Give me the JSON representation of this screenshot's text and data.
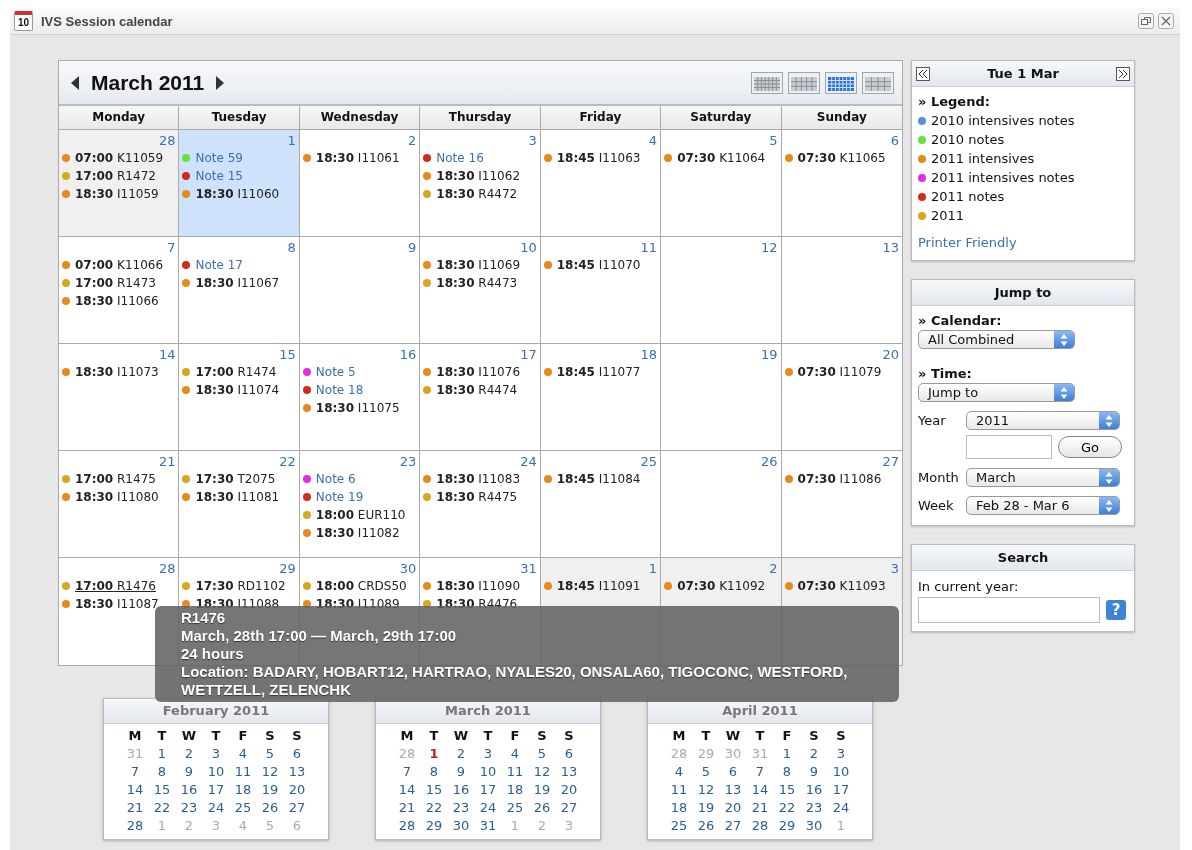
{
  "window": {
    "icon_text": "10",
    "title": "IVS Session calendar"
  },
  "calendar": {
    "title": "March 2011",
    "view_buttons": [
      {
        "selected": false
      },
      {
        "selected": false
      },
      {
        "selected": true
      },
      {
        "selected": false
      }
    ],
    "weekdays": [
      "Monday",
      "Tuesday",
      "Wednesday",
      "Thursday",
      "Friday",
      "Saturday",
      "Sunday"
    ],
    "weeks": [
      [
        {
          "day": "28",
          "other_month": true,
          "selected": false,
          "events": [
            {
              "kind": "session",
              "color": "#e68a1f",
              "time": "07:00",
              "code": "K11059"
            },
            {
              "kind": "session",
              "color": "#d7a81e",
              "time": "17:00",
              "code": "R1472"
            },
            {
              "kind": "session",
              "color": "#e68a1f",
              "time": "18:30",
              "code": "I11059"
            }
          ]
        },
        {
          "day": "1",
          "other_month": false,
          "selected": true,
          "events": [
            {
              "kind": "note",
              "color": "#66e03a",
              "code": "Note 59"
            },
            {
              "kind": "note",
              "color": "#d42a1d",
              "code": "Note 15"
            },
            {
              "kind": "session",
              "color": "#e68a1f",
              "time": "18:30",
              "code": "I11060"
            }
          ]
        },
        {
          "day": "2",
          "other_month": false,
          "selected": false,
          "events": [
            {
              "kind": "session",
              "color": "#e68a1f",
              "time": "18:30",
              "code": "I11061"
            }
          ]
        },
        {
          "day": "3",
          "other_month": false,
          "selected": false,
          "events": [
            {
              "kind": "note",
              "color": "#d42a1d",
              "code": "Note 16"
            },
            {
              "kind": "session",
              "color": "#e68a1f",
              "time": "18:30",
              "code": "I11062"
            },
            {
              "kind": "session",
              "color": "#d7a81e",
              "time": "18:30",
              "code": "R4472"
            }
          ]
        },
        {
          "day": "4",
          "other_month": false,
          "selected": false,
          "events": [
            {
              "kind": "session",
              "color": "#e68a1f",
              "time": "18:45",
              "code": "I11063"
            }
          ]
        },
        {
          "day": "5",
          "other_month": false,
          "selected": false,
          "events": [
            {
              "kind": "session",
              "color": "#e68a1f",
              "time": "07:30",
              "code": "K11064"
            }
          ]
        },
        {
          "day": "6",
          "other_month": false,
          "selected": false,
          "events": [
            {
              "kind": "session",
              "color": "#e68a1f",
              "time": "07:30",
              "code": "K11065"
            }
          ]
        }
      ],
      [
        {
          "day": "7",
          "other_month": false,
          "selected": false,
          "events": [
            {
              "kind": "session",
              "color": "#e68a1f",
              "time": "07:00",
              "code": "K11066"
            },
            {
              "kind": "session",
              "color": "#d7a81e",
              "time": "17:00",
              "code": "R1473"
            },
            {
              "kind": "session",
              "color": "#e68a1f",
              "time": "18:30",
              "code": "I11066"
            }
          ]
        },
        {
          "day": "8",
          "other_month": false,
          "selected": false,
          "events": [
            {
              "kind": "note",
              "color": "#d42a1d",
              "code": "Note 17"
            },
            {
              "kind": "session",
              "color": "#e68a1f",
              "time": "18:30",
              "code": "I11067"
            }
          ]
        },
        {
          "day": "9",
          "other_month": false,
          "selected": false
        },
        {
          "day": "10",
          "other_month": false,
          "selected": false,
          "events": [
            {
              "kind": "session",
              "color": "#e68a1f",
              "time": "18:30",
              "code": "I11069"
            },
            {
              "kind": "session",
              "color": "#d7a81e",
              "time": "18:30",
              "code": "R4473"
            }
          ]
        },
        {
          "day": "11",
          "other_month": false,
          "selected": false,
          "events": [
            {
              "kind": "session",
              "color": "#e68a1f",
              "time": "18:45",
              "code": "I11070"
            }
          ]
        },
        {
          "day": "12",
          "other_month": false,
          "selected": false
        },
        {
          "day": "13",
          "other_month": false,
          "selected": false
        }
      ],
      [
        {
          "day": "14",
          "other_month": false,
          "selected": false,
          "events": [
            {
              "kind": "session",
              "color": "#e68a1f",
              "time": "18:30",
              "code": "I11073"
            }
          ]
        },
        {
          "day": "15",
          "other_month": false,
          "selected": false,
          "events": [
            {
              "kind": "session",
              "color": "#d7a81e",
              "time": "17:00",
              "code": "R1474"
            },
            {
              "kind": "session",
              "color": "#e68a1f",
              "time": "18:30",
              "code": "I11074"
            }
          ]
        },
        {
          "day": "16",
          "other_month": false,
          "selected": false,
          "events": [
            {
              "kind": "note",
              "color": "#e02ee0",
              "code": "Note 5"
            },
            {
              "kind": "note",
              "color": "#d42a1d",
              "code": "Note 18"
            },
            {
              "kind": "session",
              "color": "#e68a1f",
              "time": "18:30",
              "code": "I11075"
            }
          ]
        },
        {
          "day": "17",
          "other_month": false,
          "selected": false,
          "events": [
            {
              "kind": "session",
              "color": "#e68a1f",
              "time": "18:30",
              "code": "I11076"
            },
            {
              "kind": "session",
              "color": "#d7a81e",
              "time": "18:30",
              "code": "R4474"
            }
          ]
        },
        {
          "day": "18",
          "other_month": false,
          "selected": false,
          "events": [
            {
              "kind": "session",
              "color": "#e68a1f",
              "time": "18:45",
              "code": "I11077"
            }
          ]
        },
        {
          "day": "19",
          "other_month": false,
          "selected": false
        },
        {
          "day": "20",
          "other_month": false,
          "selected": false,
          "events": [
            {
              "kind": "session",
              "color": "#e68a1f",
              "time": "07:30",
              "code": "I11079"
            }
          ]
        }
      ],
      [
        {
          "day": "21",
          "other_month": false,
          "selected": false,
          "events": [
            {
              "kind": "session",
              "color": "#d7a81e",
              "time": "17:00",
              "code": "R1475"
            },
            {
              "kind": "session",
              "color": "#e68a1f",
              "time": "18:30",
              "code": "I11080"
            }
          ]
        },
        {
          "day": "22",
          "other_month": false,
          "selected": false,
          "events": [
            {
              "kind": "session",
              "color": "#d7a81e",
              "time": "17:30",
              "code": "T2075"
            },
            {
              "kind": "session",
              "color": "#e68a1f",
              "time": "18:30",
              "code": "I11081"
            }
          ]
        },
        {
          "day": "23",
          "other_month": false,
          "selected": false,
          "events": [
            {
              "kind": "note",
              "color": "#e02ee0",
              "code": "Note 6"
            },
            {
              "kind": "note",
              "color": "#d42a1d",
              "code": "Note 19"
            },
            {
              "kind": "session",
              "color": "#d7a81e",
              "time": "18:00",
              "code": "EUR110"
            },
            {
              "kind": "session",
              "color": "#e68a1f",
              "time": "18:30",
              "code": "I11082"
            }
          ]
        },
        {
          "day": "24",
          "other_month": false,
          "selected": false,
          "events": [
            {
              "kind": "session",
              "color": "#e68a1f",
              "time": "18:30",
              "code": "I11083"
            },
            {
              "kind": "session",
              "color": "#d7a81e",
              "time": "18:30",
              "code": "R4475"
            }
          ]
        },
        {
          "day": "25",
          "other_month": false,
          "selected": false,
          "events": [
            {
              "kind": "session",
              "color": "#e68a1f",
              "time": "18:45",
              "code": "I11084"
            }
          ]
        },
        {
          "day": "26",
          "other_month": false,
          "selected": false
        },
        {
          "day": "27",
          "other_month": false,
          "selected": false,
          "events": [
            {
              "kind": "session",
              "color": "#e68a1f",
              "time": "07:30",
              "code": "I11086"
            }
          ]
        }
      ],
      [
        {
          "day": "28",
          "other_month": false,
          "selected": false,
          "events": [
            {
              "kind": "session",
              "color": "#d7a81e",
              "time": "17:00",
              "code": "R1476",
              "hovered": true
            },
            {
              "kind": "session",
              "color": "#e68a1f",
              "time": "18:30",
              "code": "I11087"
            }
          ]
        },
        {
          "day": "29",
          "other_month": false,
          "selected": false,
          "events": [
            {
              "kind": "session",
              "color": "#d7a81e",
              "time": "17:30",
              "code": "RD1102"
            },
            {
              "kind": "session",
              "color": "#e68a1f",
              "time": "18:30",
              "code": "I11088"
            }
          ]
        },
        {
          "day": "30",
          "other_month": false,
          "selected": false,
          "events": [
            {
              "kind": "session",
              "color": "#d7a81e",
              "time": "18:00",
              "code": "CRDS50"
            },
            {
              "kind": "session",
              "color": "#e68a1f",
              "time": "18:30",
              "code": "I11089"
            }
          ]
        },
        {
          "day": "31",
          "other_month": false,
          "selected": false,
          "events": [
            {
              "kind": "session",
              "color": "#e68a1f",
              "time": "18:30",
              "code": "I11090"
            },
            {
              "kind": "session",
              "color": "#d7a81e",
              "time": "18:30",
              "code": "R4476"
            }
          ]
        },
        {
          "day": "1",
          "other_month": true,
          "selected": false,
          "events": [
            {
              "kind": "session",
              "color": "#e68a1f",
              "time": "18:45",
              "code": "I11091"
            }
          ]
        },
        {
          "day": "2",
          "other_month": true,
          "selected": false,
          "events": [
            {
              "kind": "session",
              "color": "#e68a1f",
              "time": "07:30",
              "code": "K11092"
            }
          ]
        },
        {
          "day": "3",
          "other_month": true,
          "selected": false,
          "events": [
            {
              "kind": "session",
              "color": "#e68a1f",
              "time": "07:30",
              "code": "K11093"
            }
          ]
        }
      ]
    ]
  },
  "tooltip": {
    "title": "R1476",
    "range": "March, 28th 17:00 — March, 29th 17:00",
    "duration": "24 hours",
    "location": "Location: BADARY, HOBART12, HARTRAO, NYALES20, ONSALA60, TIGOCONC, WESTFORD, WETTZELL, ZELENCHK"
  },
  "mini_calendars": [
    {
      "title": "February 2011",
      "weekdays": [
        "M",
        "T",
        "W",
        "T",
        "F",
        "S",
        "S"
      ],
      "weeks": [
        [
          {
            "day": "31",
            "kind": "other"
          },
          {
            "day": "1",
            "kind": "current"
          },
          {
            "day": "2",
            "kind": "current"
          },
          {
            "day": "3",
            "kind": "current"
          },
          {
            "day": "4",
            "kind": "current"
          },
          {
            "day": "5",
            "kind": "current"
          },
          {
            "day": "6",
            "kind": "current"
          }
        ],
        [
          {
            "day": "7",
            "kind": "current"
          },
          {
            "day": "8",
            "kind": "current"
          },
          {
            "day": "9",
            "kind": "current"
          },
          {
            "day": "10",
            "kind": "current"
          },
          {
            "day": "11",
            "kind": "current"
          },
          {
            "day": "12",
            "kind": "current"
          },
          {
            "day": "13",
            "kind": "current"
          }
        ],
        [
          {
            "day": "14",
            "kind": "current"
          },
          {
            "day": "15",
            "kind": "current"
          },
          {
            "day": "16",
            "kind": "current"
          },
          {
            "day": "17",
            "kind": "current"
          },
          {
            "day": "18",
            "kind": "current"
          },
          {
            "day": "19",
            "kind": "current"
          },
          {
            "day": "20",
            "kind": "current"
          }
        ],
        [
          {
            "day": "21",
            "kind": "current"
          },
          {
            "day": "22",
            "kind": "current"
          },
          {
            "day": "23",
            "kind": "current"
          },
          {
            "day": "24",
            "kind": "current"
          },
          {
            "day": "25",
            "kind": "current"
          },
          {
            "day": "26",
            "kind": "current"
          },
          {
            "day": "27",
            "kind": "current"
          }
        ],
        [
          {
            "day": "28",
            "kind": "current"
          },
          {
            "day": "1",
            "kind": "other"
          },
          {
            "day": "2",
            "kind": "other"
          },
          {
            "day": "3",
            "kind": "other"
          },
          {
            "day": "4",
            "kind": "other"
          },
          {
            "day": "5",
            "kind": "other"
          },
          {
            "day": "6",
            "kind": "other"
          }
        ]
      ]
    },
    {
      "title": "March 2011",
      "weekdays": [
        "M",
        "T",
        "W",
        "T",
        "F",
        "S",
        "S"
      ],
      "weeks": [
        [
          {
            "day": "28",
            "kind": "other"
          },
          {
            "day": "1",
            "kind": "today"
          },
          {
            "day": "2",
            "kind": "current"
          },
          {
            "day": "3",
            "kind": "current"
          },
          {
            "day": "4",
            "kind": "current"
          },
          {
            "day": "5",
            "kind": "current"
          },
          {
            "day": "6",
            "kind": "current"
          }
        ],
        [
          {
            "day": "7",
            "kind": "current"
          },
          {
            "day": "8",
            "kind": "current"
          },
          {
            "day": "9",
            "kind": "current"
          },
          {
            "day": "10",
            "kind": "current"
          },
          {
            "day": "11",
            "kind": "current"
          },
          {
            "day": "12",
            "kind": "current"
          },
          {
            "day": "13",
            "kind": "current"
          }
        ],
        [
          {
            "day": "14",
            "kind": "current"
          },
          {
            "day": "15",
            "kind": "current"
          },
          {
            "day": "16",
            "kind": "current"
          },
          {
            "day": "17",
            "kind": "current"
          },
          {
            "day": "18",
            "kind": "current"
          },
          {
            "day": "19",
            "kind": "current"
          },
          {
            "day": "20",
            "kind": "current"
          }
        ],
        [
          {
            "day": "21",
            "kind": "current"
          },
          {
            "day": "22",
            "kind": "current"
          },
          {
            "day": "23",
            "kind": "current"
          },
          {
            "day": "24",
            "kind": "current"
          },
          {
            "day": "25",
            "kind": "current"
          },
          {
            "day": "26",
            "kind": "current"
          },
          {
            "day": "27",
            "kind": "current"
          }
        ],
        [
          {
            "day": "28",
            "kind": "current"
          },
          {
            "day": "29",
            "kind": "current"
          },
          {
            "day": "30",
            "kind": "current"
          },
          {
            "day": "31",
            "kind": "current"
          },
          {
            "day": "1",
            "kind": "other"
          },
          {
            "day": "2",
            "kind": "other"
          },
          {
            "day": "3",
            "kind": "other"
          }
        ]
      ]
    },
    {
      "title": "April 2011",
      "weekdays": [
        "M",
        "T",
        "W",
        "T",
        "F",
        "S",
        "S"
      ],
      "weeks": [
        [
          {
            "day": "28",
            "kind": "other"
          },
          {
            "day": "29",
            "kind": "other"
          },
          {
            "day": "30",
            "kind": "other"
          },
          {
            "day": "31",
            "kind": "other"
          },
          {
            "day": "1",
            "kind": "current"
          },
          {
            "day": "2",
            "kind": "current"
          },
          {
            "day": "3",
            "kind": "current"
          }
        ],
        [
          {
            "day": "4",
            "kind": "current"
          },
          {
            "day": "5",
            "kind": "current"
          },
          {
            "day": "6",
            "kind": "current"
          },
          {
            "day": "7",
            "kind": "current"
          },
          {
            "day": "8",
            "kind": "current"
          },
          {
            "day": "9",
            "kind": "current"
          },
          {
            "day": "10",
            "kind": "current"
          }
        ],
        [
          {
            "day": "11",
            "kind": "current"
          },
          {
            "day": "12",
            "kind": "current"
          },
          {
            "day": "13",
            "kind": "current"
          },
          {
            "day": "14",
            "kind": "current"
          },
          {
            "day": "15",
            "kind": "current"
          },
          {
            "day": "16",
            "kind": "current"
          },
          {
            "day": "17",
            "kind": "current"
          }
        ],
        [
          {
            "day": "18",
            "kind": "current"
          },
          {
            "day": "19",
            "kind": "current"
          },
          {
            "day": "20",
            "kind": "current"
          },
          {
            "day": "21",
            "kind": "current"
          },
          {
            "day": "22",
            "kind": "current"
          },
          {
            "day": "23",
            "kind": "current"
          },
          {
            "day": "24",
            "kind": "current"
          }
        ],
        [
          {
            "day": "25",
            "kind": "current"
          },
          {
            "day": "26",
            "kind": "current"
          },
          {
            "day": "27",
            "kind": "current"
          },
          {
            "day": "28",
            "kind": "current"
          },
          {
            "day": "29",
            "kind": "current"
          },
          {
            "day": "30",
            "kind": "current"
          },
          {
            "day": "1",
            "kind": "other"
          }
        ]
      ]
    }
  ],
  "sidebar": {
    "date_panel": {
      "title": "Tue 1 Mar",
      "legend_title": "» Legend:",
      "legend": [
        {
          "label": "2010 intensives notes",
          "color": "#5b8ed6"
        },
        {
          "label": "2010 notes",
          "color": "#66e03a"
        },
        {
          "label": "2011 intensives",
          "color": "#e68a1f"
        },
        {
          "label": "2011 intensives notes",
          "color": "#e02ee0"
        },
        {
          "label": "2011 notes",
          "color": "#d42a1d"
        },
        {
          "label": "2011",
          "color": "#d7a81e"
        }
      ],
      "link": "Printer Friendly"
    },
    "jump_panel": {
      "title": "Jump to",
      "calendar_label": "» Calendar:",
      "calendar_value": "All Combined",
      "time_label": "» Time:",
      "time_value": "Jump to",
      "year_label": "Year",
      "year_value": "2011",
      "go_button": "Go",
      "month_label": "Month",
      "month_value": "March",
      "week_label": "Week",
      "week_value": "Feb 28 - Mar 6"
    },
    "search_panel": {
      "title": "Search",
      "label": "In current year:",
      "help": "?"
    }
  }
}
